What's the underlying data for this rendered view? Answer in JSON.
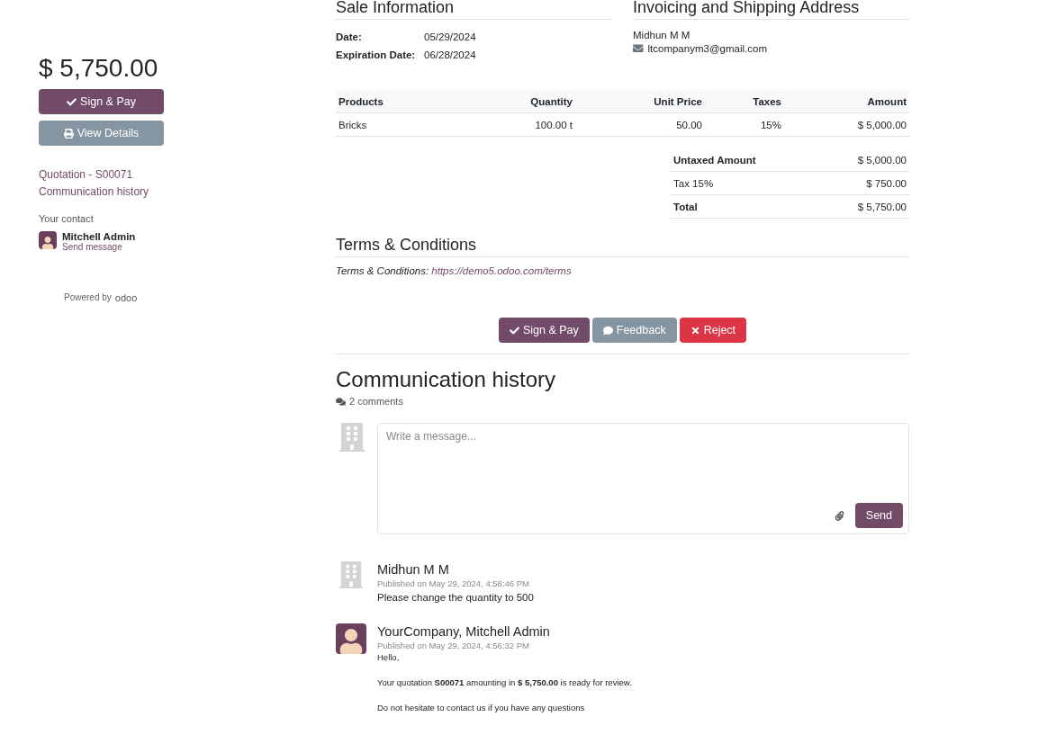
{
  "sidebar": {
    "total": "$ 5,750.00",
    "buttons": [
      {
        "label": "Sign & Pay",
        "kind": "sign"
      },
      {
        "label": "View Details",
        "kind": "print"
      }
    ],
    "links": [
      "Quotation - S00071",
      "Communication history"
    ],
    "contact_label": "Your contact",
    "contact": {
      "name": "Mitchell Admin",
      "action": "Send message"
    },
    "powered_by": "Powered by",
    "brand": "odoo"
  },
  "sale_information": {
    "title": "Sale Information",
    "fields": [
      {
        "label": "Date:",
        "value": "05/29/2024"
      },
      {
        "label": "Expiration Date:",
        "value": "06/28/2024"
      }
    ]
  },
  "address": {
    "title": "Invoicing and Shipping Address",
    "name": "Midhun M M",
    "email": "ltcompanym3@gmail.com"
  },
  "table": {
    "columns": [
      "Products",
      "Quantity",
      "Unit Price",
      "Taxes",
      "Amount"
    ],
    "rows": [
      [
        "Bricks",
        "100.00 t",
        "50.00",
        "15%",
        "$ 5,000.00"
      ]
    ]
  },
  "totals": [
    {
      "label": "Untaxed Amount",
      "value": "$ 5,000.00",
      "bold": true
    },
    {
      "label": "Tax 15%",
      "value": "$ 750.00",
      "bold": false
    },
    {
      "label": "Total",
      "value": "$ 5,750.00",
      "bold": true
    }
  ],
  "terms": {
    "title": "Terms & Conditions",
    "label": "Terms & Conditions:",
    "link": "https://demo5.odoo.com/terms"
  },
  "actions": [
    {
      "label": "Sign & Pay",
      "kind": "sign"
    },
    {
      "label": "Feedback",
      "kind": "feedback"
    },
    {
      "label": "Reject",
      "kind": "reject"
    }
  ],
  "communication": {
    "title": "Communication history",
    "count": "2 comments",
    "composer": {
      "placeholder": "Write a message...",
      "send": "Send"
    },
    "messages": [
      {
        "author": "Midhun M M",
        "date": "Published on May 29, 2024, 4:58:46 PM",
        "kind": "comment",
        "body": [
          "Please change the quantity to 500"
        ]
      },
      {
        "author": "YourCompany, Mitchell Admin",
        "date": "Published on May 29, 2024, 4:56:32 PM",
        "kind": "email",
        "body": [
          "Hello,",
          "Your quotation **S00071** amounting in **$ 5,750.00** is ready for review.",
          "Do not hesitate to contact us if you have any questions"
        ]
      }
    ]
  }
}
